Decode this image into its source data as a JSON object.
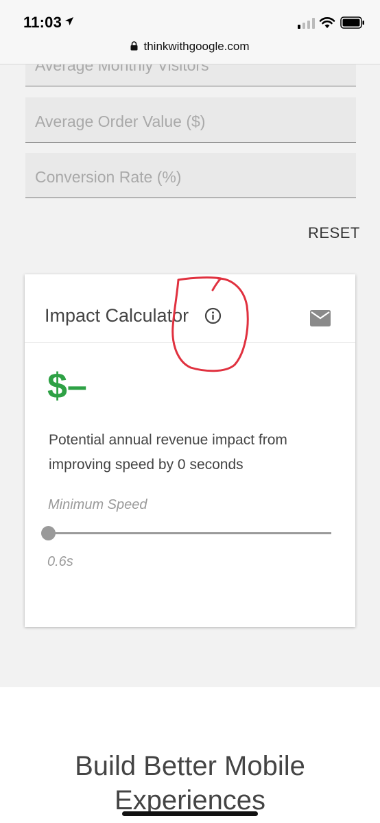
{
  "status_bar": {
    "time": "11:03",
    "location_icon": "location-arrow-icon",
    "signal_icon": "cellular-signal-icon",
    "wifi_icon": "wifi-icon",
    "battery_icon": "battery-icon"
  },
  "browser": {
    "lock_icon": "lock-icon",
    "url": "thinkwithgoogle.com"
  },
  "form": {
    "fields": [
      {
        "label": "Average Monthly Visitors"
      },
      {
        "label": "Average Order Value ($)"
      },
      {
        "label": "Conversion Rate (%)"
      }
    ],
    "reset_label": "RESET"
  },
  "calculator": {
    "title": "Impact Calculator",
    "info_icon": "info-icon",
    "email_icon": "mail-icon",
    "value": "$–",
    "description": "Potential annual revenue impact from improving speed by 0 seconds",
    "slider": {
      "label": "Minimum Speed",
      "value_text": "0.6s",
      "position_fraction": 0
    }
  },
  "annotation": {
    "color": "#e0313f",
    "target": "info-icon"
  },
  "section": {
    "heading": "Build Better Mobile Experiences"
  },
  "colors": {
    "accent_green": "#2ea145",
    "slider_gray": "#9a9a9a"
  }
}
